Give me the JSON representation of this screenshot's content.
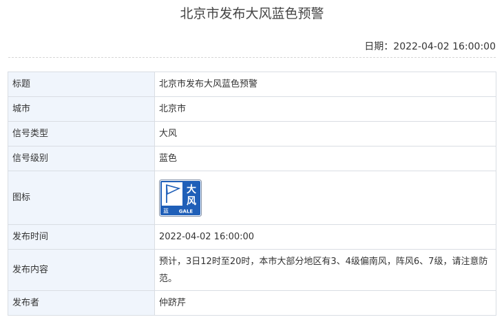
{
  "page": {
    "title": "北京市发布大风蓝色预警",
    "date_label": "日期：",
    "date_value": "2022-04-02 16:00:00"
  },
  "table": {
    "rows": [
      {
        "label": "标题",
        "value": "北京市发布大风蓝色预警"
      },
      {
        "label": "城市",
        "value": "北京市"
      },
      {
        "label": "信号类型",
        "value": "大风"
      },
      {
        "label": "信号级别",
        "value": "蓝色"
      },
      {
        "label": "图标",
        "icon": "gale-blue-warning-icon"
      },
      {
        "label": "发布时间",
        "value": "2022-04-02 16:00:00"
      },
      {
        "label": "发布内容",
        "value": "预计，3日12时至20时，本市大部分地区有3、4级偏南风，阵风6、7级，请注意防范。"
      },
      {
        "label": "发布者",
        "value": "仲跻芹"
      }
    ]
  },
  "warning_icon": {
    "char_top": "大",
    "char_bottom": "风",
    "level_char": "蓝",
    "english": "GALE",
    "color": "#1f5fb8",
    "border": "#7f8ea6"
  }
}
